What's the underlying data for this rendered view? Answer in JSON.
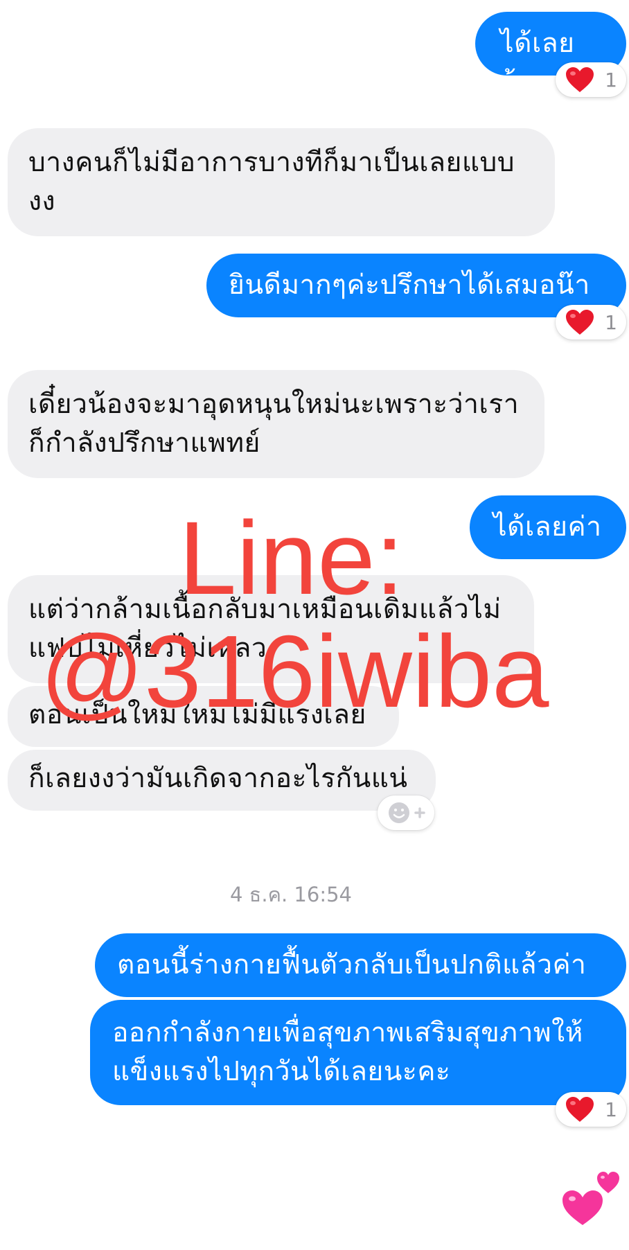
{
  "messages": [
    {
      "id": "m1",
      "text": "ได้เลยจ้า"
    },
    {
      "id": "m2",
      "text": "บางคนก็ไม่มีอาการบางทีก็มาเป็นเลยแบบงง"
    },
    {
      "id": "m3",
      "text": "ยินดีมากๆค่ะปรึกษาได้เสมอน๊า"
    },
    {
      "id": "m4",
      "text": "เดี๋ยวน้องจะมาอุดหนุนใหม่นะเพราะว่าเราก็กำลังปรึกษาแพทย์"
    },
    {
      "id": "m5",
      "text": "ได้เลยค่า"
    },
    {
      "id": "m6",
      "text": "แต่ว่ากล้ามเนื้อกลับมาเหมือนเดิมแล้วไม่แฟบไม่เหี่ยวไม่เหลว"
    },
    {
      "id": "m7",
      "text": "ตอนเป็นใหม่ใหม่ไม่มีแรงเลย"
    },
    {
      "id": "m8",
      "text": "ก็เลยงงว่ามันเกิดจากอะไรกันแน่"
    },
    {
      "id": "m9",
      "text": "ตอนนี้ร่างกายฟื้นตัวกลับเป็นปกติแล้วค่า"
    },
    {
      "id": "m10",
      "text": "ออกกำลังกายเพื่อสุขภาพเสริมสุขภาพให้แข็งแรงไปทุกวันได้เลยนะคะ"
    }
  ],
  "reactions": {
    "heart_count": "1"
  },
  "timestamp": "4 ธ.ค. 16:54",
  "watermark": {
    "line1": "Line:",
    "line2": "@316iwiba"
  },
  "colors": {
    "outgoing": "#0a84ff",
    "incoming": "#efeff1",
    "watermark": "#f2443c",
    "heart": "#e8192c"
  },
  "icons": {
    "reaction": "heart-icon",
    "add_reaction": "smiley-plus-icon",
    "final": "two-hearts-icon"
  }
}
